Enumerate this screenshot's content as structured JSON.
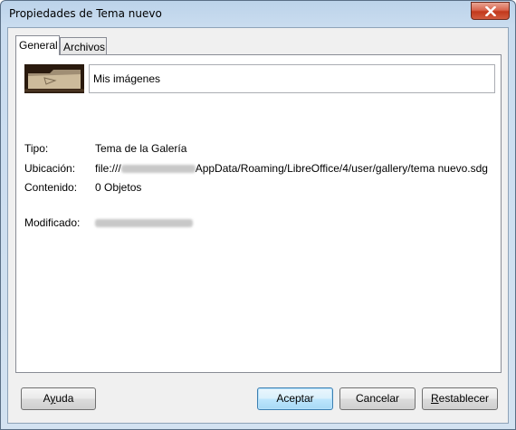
{
  "window": {
    "title": "Propiedades de Tema nuevo"
  },
  "tabs": [
    {
      "label": "General",
      "active": true
    },
    {
      "label": "Archivos",
      "active": false
    }
  ],
  "general": {
    "name_value": "Mis imágenes",
    "tipo_label": "Tipo:",
    "tipo_value": "Tema de la Galería",
    "ubicacion_label": "Ubicación:",
    "ubicacion_prefix": "file:///",
    "ubicacion_suffix": "AppData/Roaming/LibreOffice/4/user/gallery/tema nuevo.sdg",
    "contenido_label": "Contenido:",
    "contenido_value": "0 Objetos",
    "modificado_label": "Modificado:"
  },
  "buttons": {
    "ayuda": {
      "pre": "A",
      "mn": "y",
      "post": "uda"
    },
    "aceptar": "Aceptar",
    "cancelar": "Cancelar",
    "restablecer": {
      "mn": "R",
      "post": "establecer"
    }
  },
  "icons": {
    "close": "close-icon",
    "thumbnail": "folder-thumbnail"
  }
}
